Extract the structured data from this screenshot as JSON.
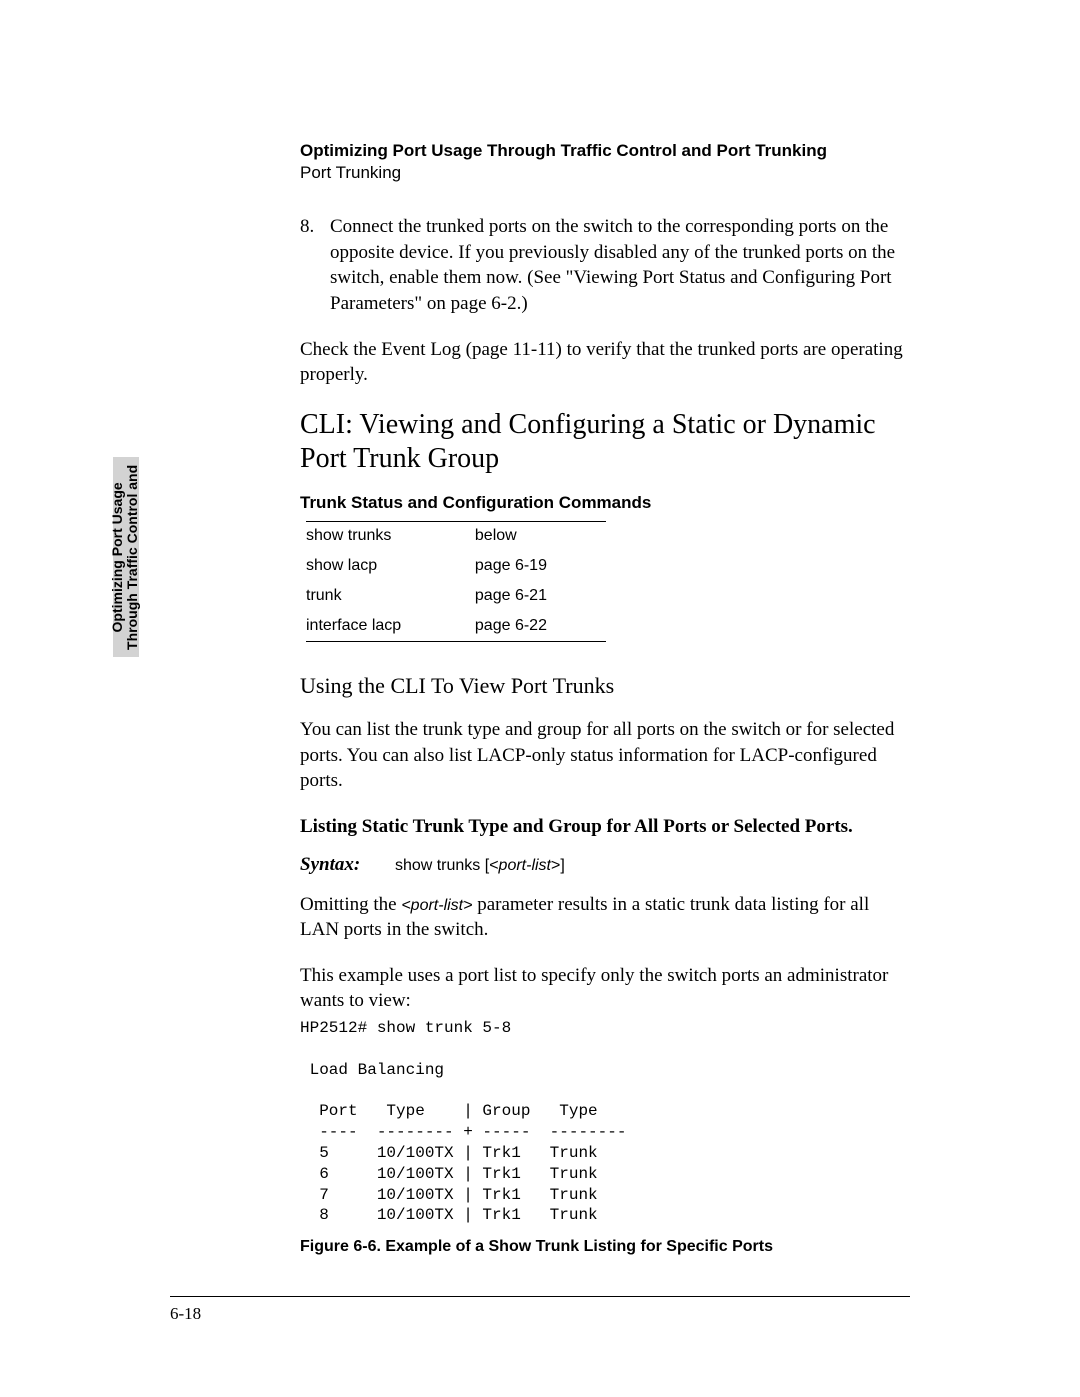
{
  "header": {
    "chapter_title": "Optimizing Port Usage Through Traffic Control and Port Trunking",
    "chapter_sub": "Port Trunking"
  },
  "side_tab": {
    "line1": "Optimizing Port Usage",
    "line2": "Through Traffic Control and"
  },
  "step8": {
    "num": "8.",
    "text": "Connect the trunked ports on the switch to the corresponding ports on the opposite device. If you previously disabled any of the trunked ports on the switch, enable them now. (See \"Viewing Port Status and Configuring Port Parameters\" on page 6-2.)"
  },
  "check_text": "Check the Event Log (page 11-11) to verify that the trunked ports are operating properly.",
  "h2": "CLI: Viewing and Configuring a Static or Dynamic Port Trunk Group",
  "table": {
    "title": "Trunk Status and Configuration Commands",
    "rows": [
      {
        "cmd": "show trunks",
        "ref": "below"
      },
      {
        "cmd": "show lacp",
        "ref": "page 6-19"
      },
      {
        "cmd": "trunk",
        "ref": "page 6-21"
      },
      {
        "cmd": "interface lacp",
        "ref": "page 6-22"
      }
    ]
  },
  "h3": "Using the CLI To View Port Trunks",
  "p_using": "You can list the trunk type and group for all ports on the switch or for selected ports. You can also list LACP-only status information for LACP-configured ports.",
  "bold_listing": "Listing Static Trunk Type and Group for All Ports or Selected Ports.",
  "syntax": {
    "label": "Syntax:",
    "cmd_pre": "show trunks [<",
    "cmd_it": "port-list",
    "cmd_post": ">]"
  },
  "omit": {
    "pre": "Omitting the ",
    "it": "<port-list>",
    "post": " parameter results in a static trunk data listing for all LAN ports in the switch."
  },
  "p_example": "This example uses a port list to specify only the switch ports an administrator wants to view:",
  "cli_output": "HP2512# show trunk 5-8\n\n Load Balancing\n\n  Port   Type    | Group   Type\n  ----  -------- + -----  --------\n  5     10/100TX | Trk1   Trunk\n  6     10/100TX | Trk1   Trunk\n  7     10/100TX | Trk1   Trunk\n  8     10/100TX | Trk1   Trunk",
  "fig_caption": "Figure 6-6.  Example of a Show Trunk Listing for Specific Ports",
  "page_num": "6-18"
}
